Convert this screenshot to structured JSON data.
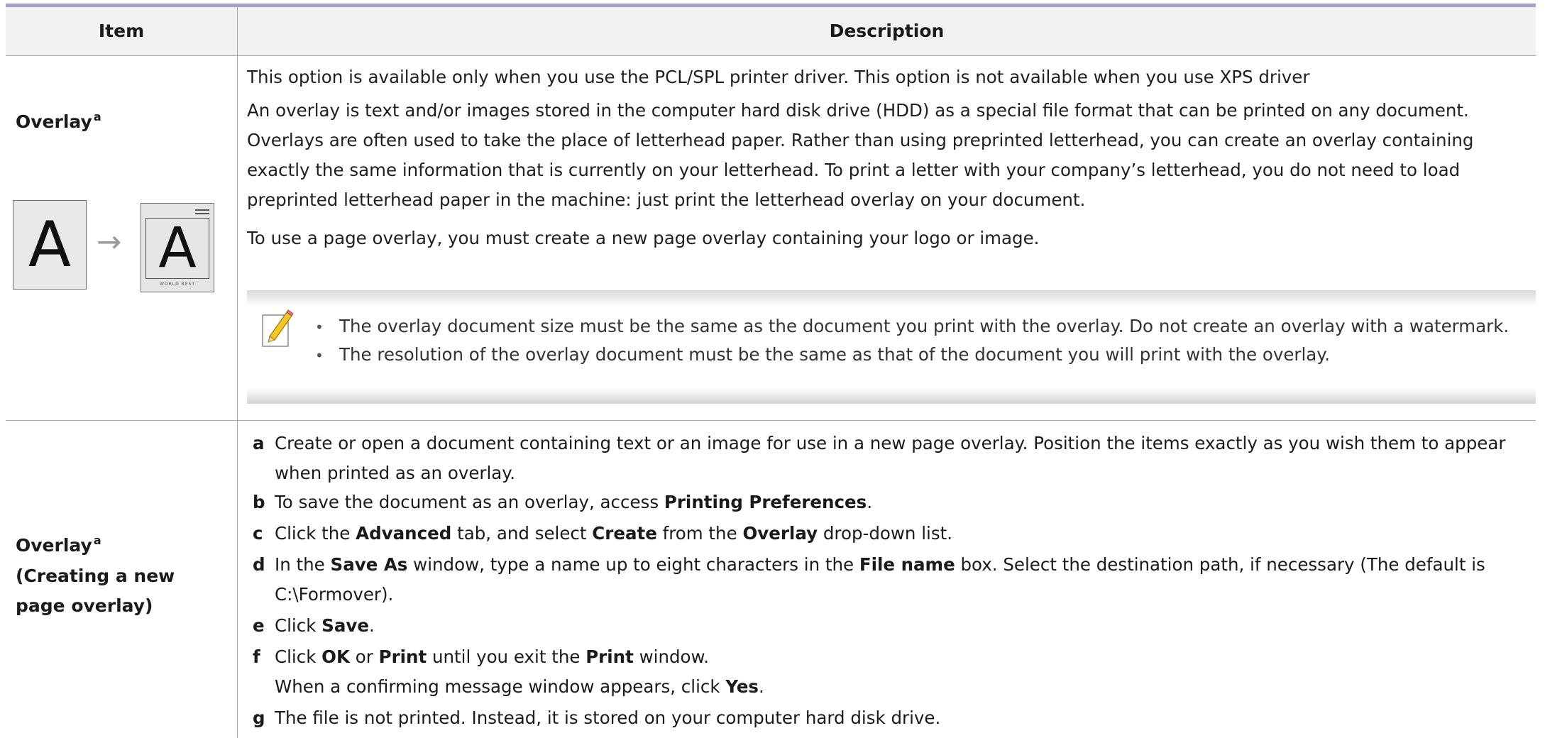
{
  "header": {
    "item": "Item",
    "description": "Description"
  },
  "row1": {
    "item_title": "Overlay",
    "item_sup": "a",
    "illustration": {
      "before_letter": "A",
      "arrow": "→",
      "after_letter": "A",
      "after_caption": "WORLD BEST"
    },
    "p1": "This option is available only when you use the PCL/SPL printer driver. This option is not available when you use XPS driver",
    "p2": "An overlay is text and/or images stored in the computer hard disk drive (HDD) as a special file format that can be printed on any document. Overlays are often used to take the place of letterhead paper. Rather than using preprinted letterhead, you can create an overlay containing exactly the same information that is currently on your letterhead. To print a letter with your company’s letterhead, you do not need to load preprinted letterhead paper in the machine: just print the letterhead overlay on your document.",
    "p3": "To use a page overlay, you must create a new page overlay containing your logo or image.",
    "note": {
      "icon": "note-pencil-icon",
      "bullets": [
        "The overlay document size must be the same as the document you print with the overlay. Do not create an overlay with a watermark.",
        "The resolution of the overlay document must be the same as that of the document you will print with the overlay."
      ]
    }
  },
  "row2": {
    "item_title": "Overlay",
    "item_sup": "a",
    "item_sub": "(Creating a new page overlay)",
    "steps": {
      "a": {
        "label": "a",
        "text": "Create or open a document containing text or an image for use in a new page overlay. Position the items exactly as you wish them to appear when printed as an overlay."
      },
      "b": {
        "label": "b",
        "t1": "To save the document as an overlay, access ",
        "b1": "Printing Preferences",
        "t2": "."
      },
      "c": {
        "label": "c",
        "t1": "Click the ",
        "b1": "Advanced",
        "t2": " tab, and select ",
        "b2": "Create",
        "t3": " from the ",
        "b3": "Overlay",
        "t4": " drop-down list."
      },
      "d": {
        "label": "d",
        "t1": "In the ",
        "b1": "Save As",
        "t2": " window, type a name up to eight characters in the ",
        "b2": "File name",
        "t3": " box. Select the destination path, if necessary (The default is C:\\Formover)."
      },
      "e": {
        "label": "e",
        "t1": "Click ",
        "b1": "Save",
        "t2": "."
      },
      "f": {
        "label": "f",
        "t1": "Click ",
        "b1": "OK",
        "t2": " or ",
        "b2": "Print",
        "t3": " until you exit the ",
        "b3": "Print",
        "t4": " window."
      },
      "f2": {
        "t1": "When a confirming message window appears, click ",
        "b1": "Yes",
        "t2": "."
      },
      "g": {
        "label": "g",
        "text": "The file is not printed. Instead, it is stored on your computer hard disk drive."
      }
    }
  }
}
